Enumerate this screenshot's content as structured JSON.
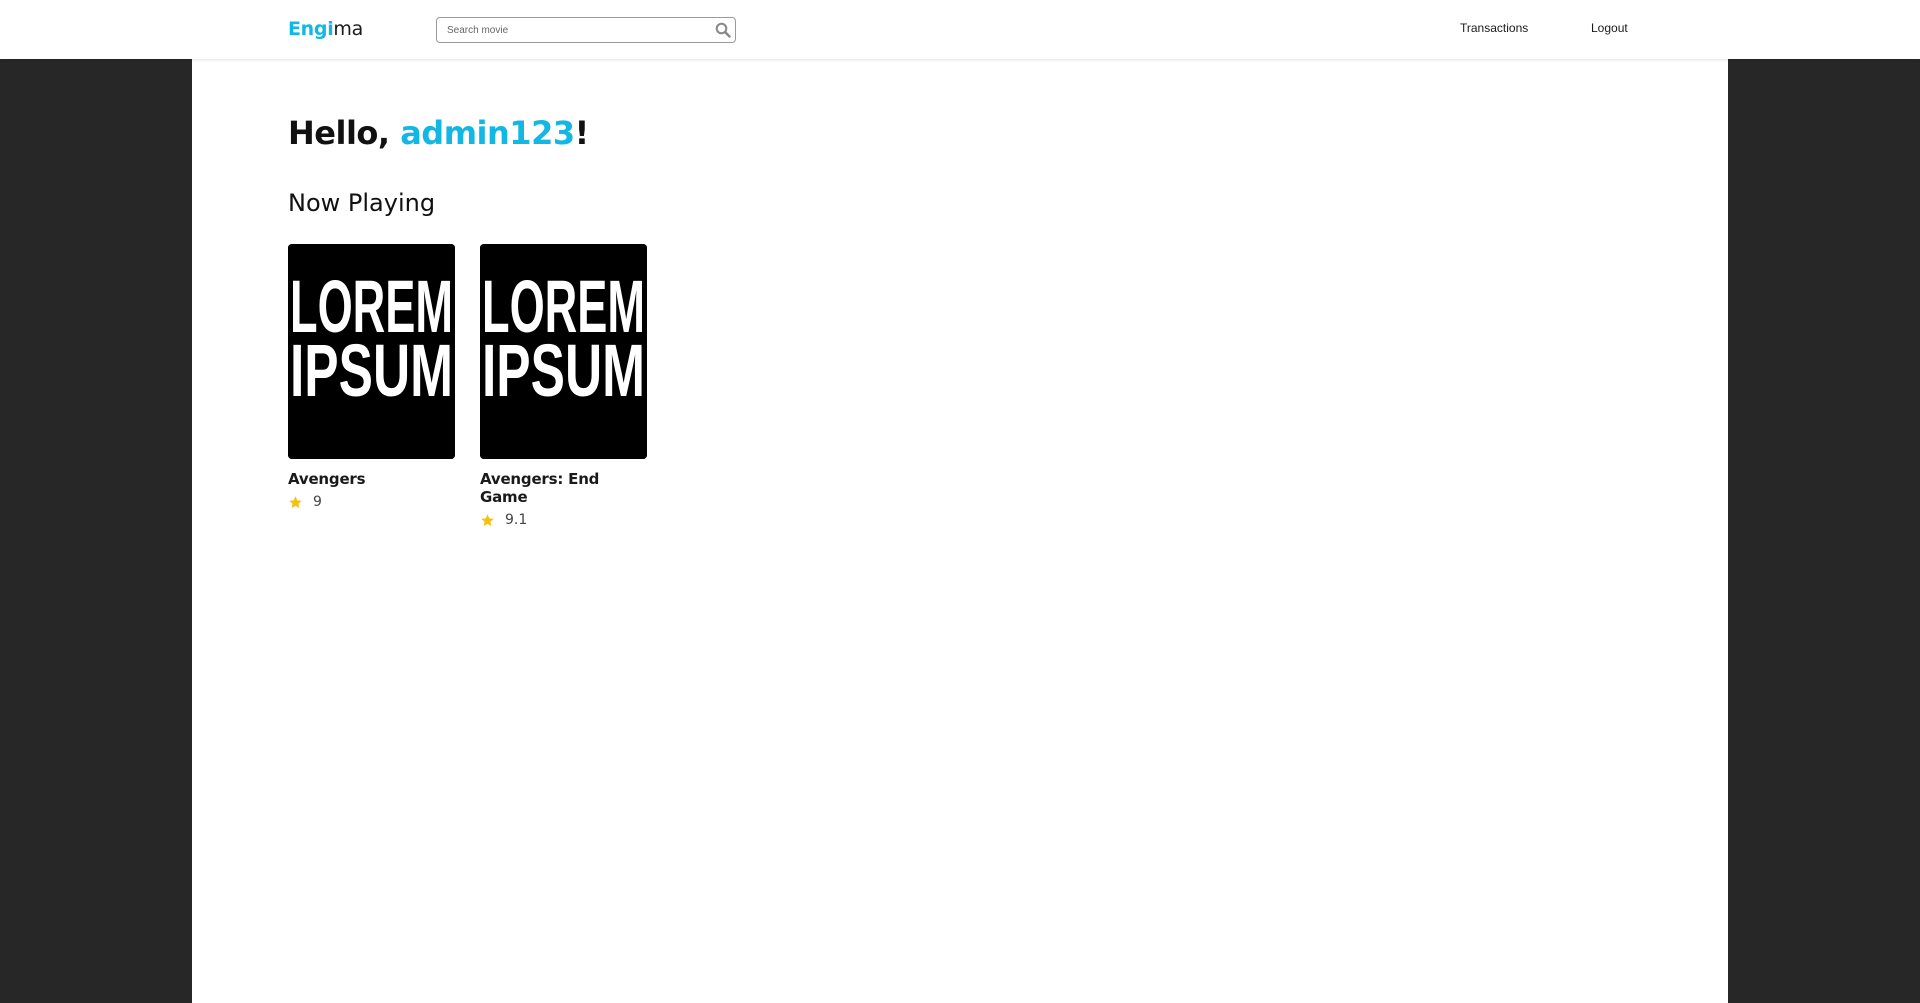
{
  "header": {
    "logo_part1": "Engi",
    "logo_part2": "ma",
    "search_placeholder": "Search movie",
    "search_icon": "search-icon",
    "nav": {
      "transactions": "Transactions",
      "logout": "Logout"
    }
  },
  "main": {
    "greeting_prefix": "Hello, ",
    "username": "admin123",
    "greeting_suffix": "!",
    "section_title": "Now Playing",
    "movies": [
      {
        "title": "Avengers",
        "rating": "9",
        "poster_text_line1": "LOREM",
        "poster_text_line2": "IPSUM"
      },
      {
        "title": "Avengers: End Game",
        "rating": "9.1",
        "poster_text_line1": "LOREM",
        "poster_text_line2": "IPSUM"
      }
    ]
  },
  "colors": {
    "accent": "#12b7e3",
    "background": "#272727",
    "panel": "#ffffff",
    "star": "#f4c20d"
  }
}
